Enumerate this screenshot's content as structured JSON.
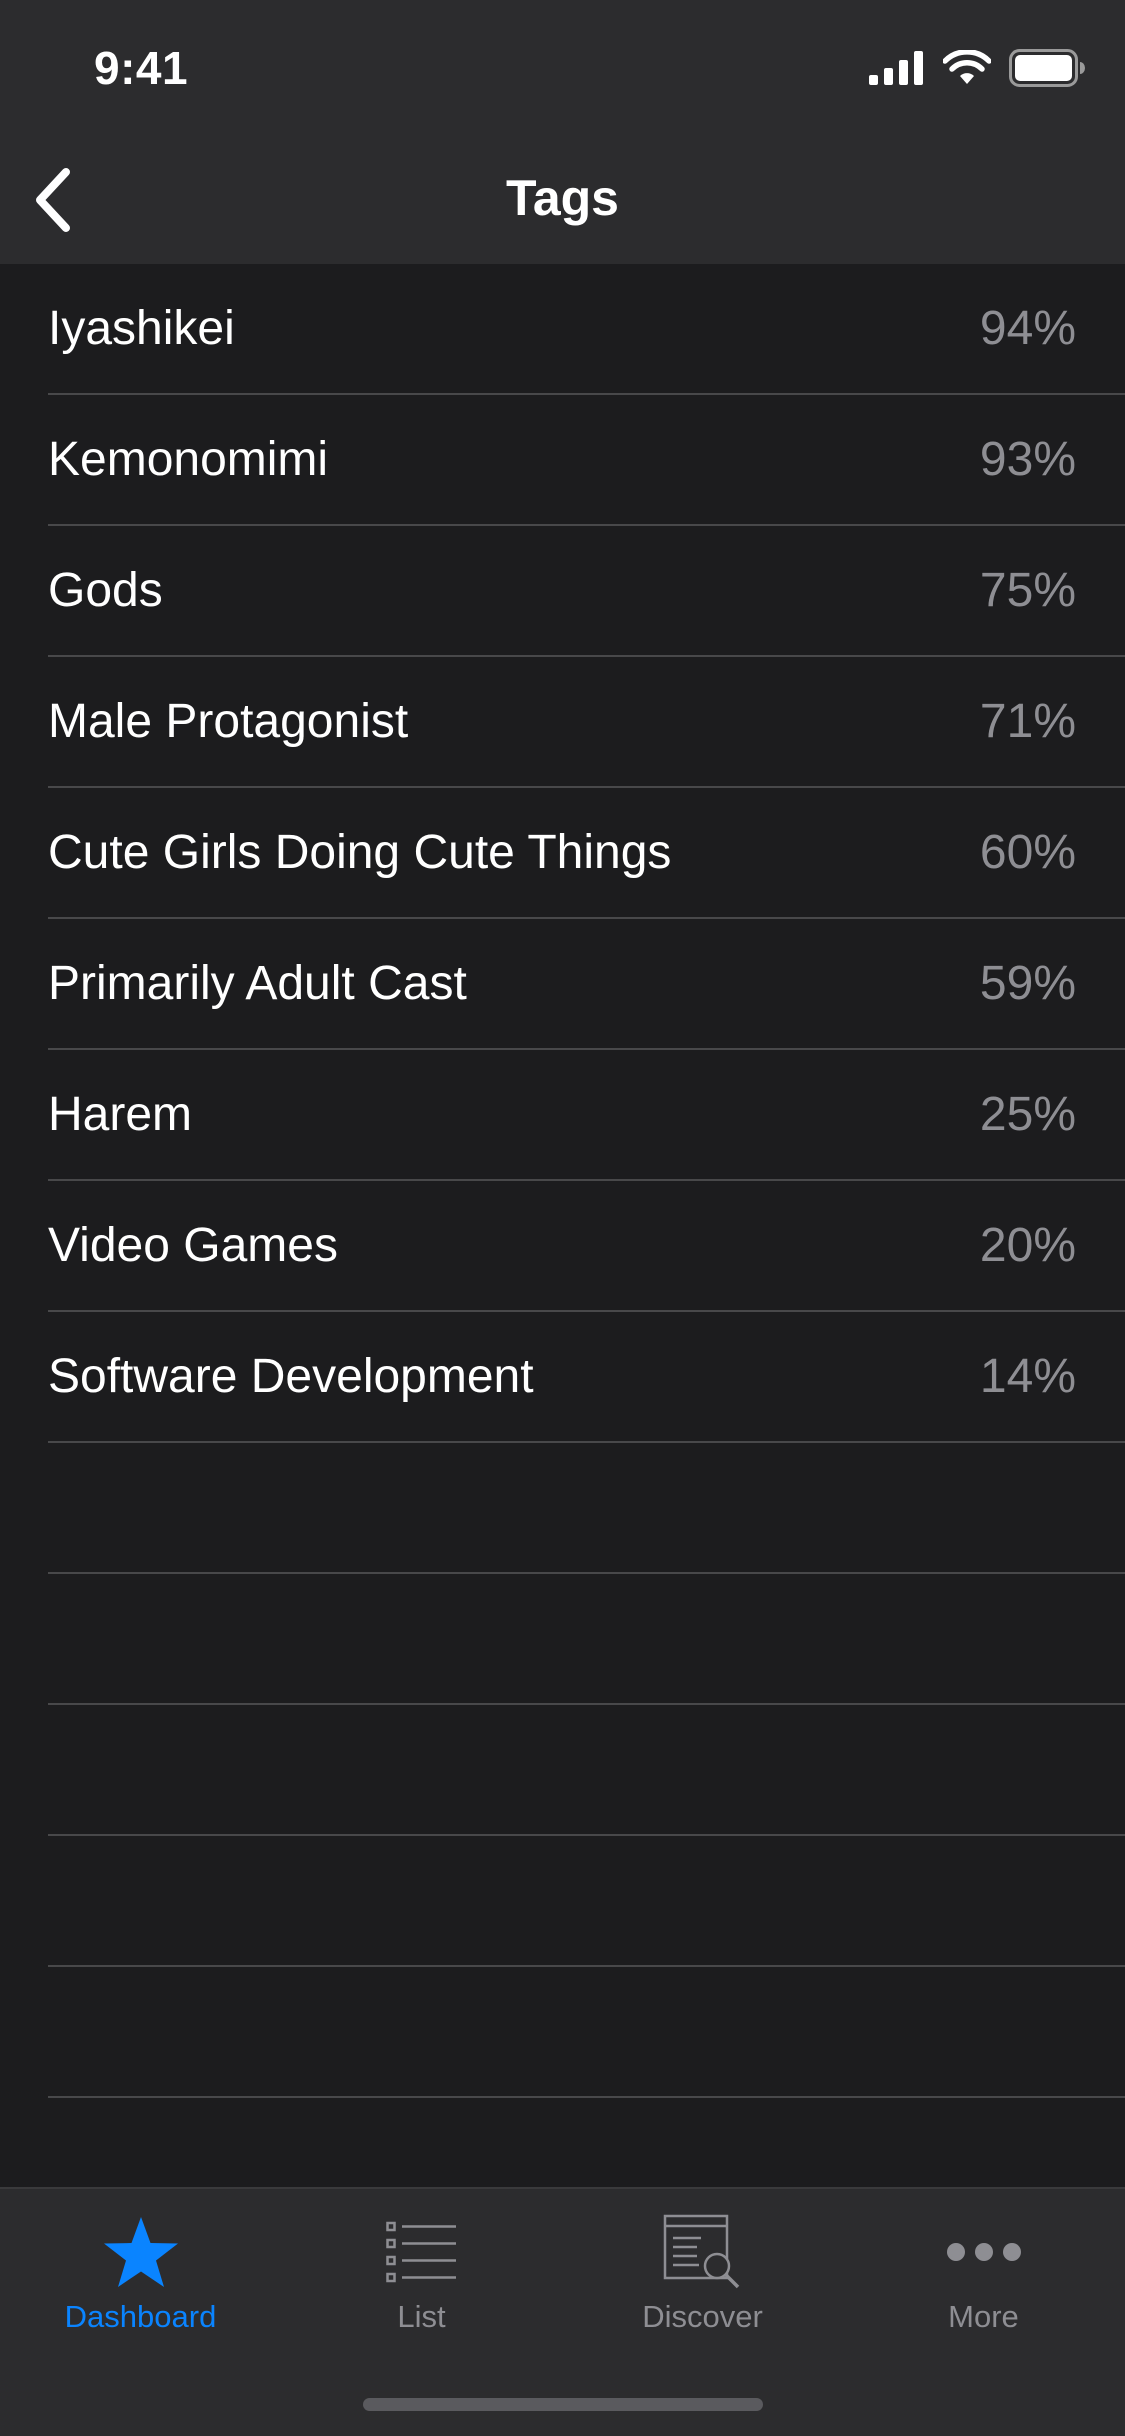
{
  "status_bar": {
    "time": "9:41",
    "icons": [
      "cellular-signal-icon",
      "wifi-icon",
      "battery-icon"
    ]
  },
  "nav": {
    "title": "Tags",
    "back_icon": "chevron-left-icon"
  },
  "tags": [
    {
      "name": "Iyashikei",
      "percent": "94%"
    },
    {
      "name": "Kemonomimi",
      "percent": "93%"
    },
    {
      "name": "Gods",
      "percent": "75%"
    },
    {
      "name": "Male Protagonist",
      "percent": "71%"
    },
    {
      "name": "Cute Girls Doing Cute Things",
      "percent": "60%"
    },
    {
      "name": "Primarily Adult Cast",
      "percent": "59%"
    },
    {
      "name": "Harem",
      "percent": "25%"
    },
    {
      "name": "Video Games",
      "percent": "20%"
    },
    {
      "name": "Software Development",
      "percent": "14%"
    }
  ],
  "tab_bar": {
    "tabs": [
      {
        "label": "Dashboard",
        "icon": "star-icon",
        "active": true
      },
      {
        "label": "List",
        "icon": "list-icon",
        "active": false
      },
      {
        "label": "Discover",
        "icon": "discover-icon",
        "active": false
      },
      {
        "label": "More",
        "icon": "ellipsis-icon",
        "active": false
      }
    ]
  },
  "colors": {
    "accent": "#0a84ff",
    "background": "#1c1c1e",
    "bar_background": "#2c2c2e",
    "secondary_text": "#8e8e93",
    "separator": "#48484a"
  }
}
